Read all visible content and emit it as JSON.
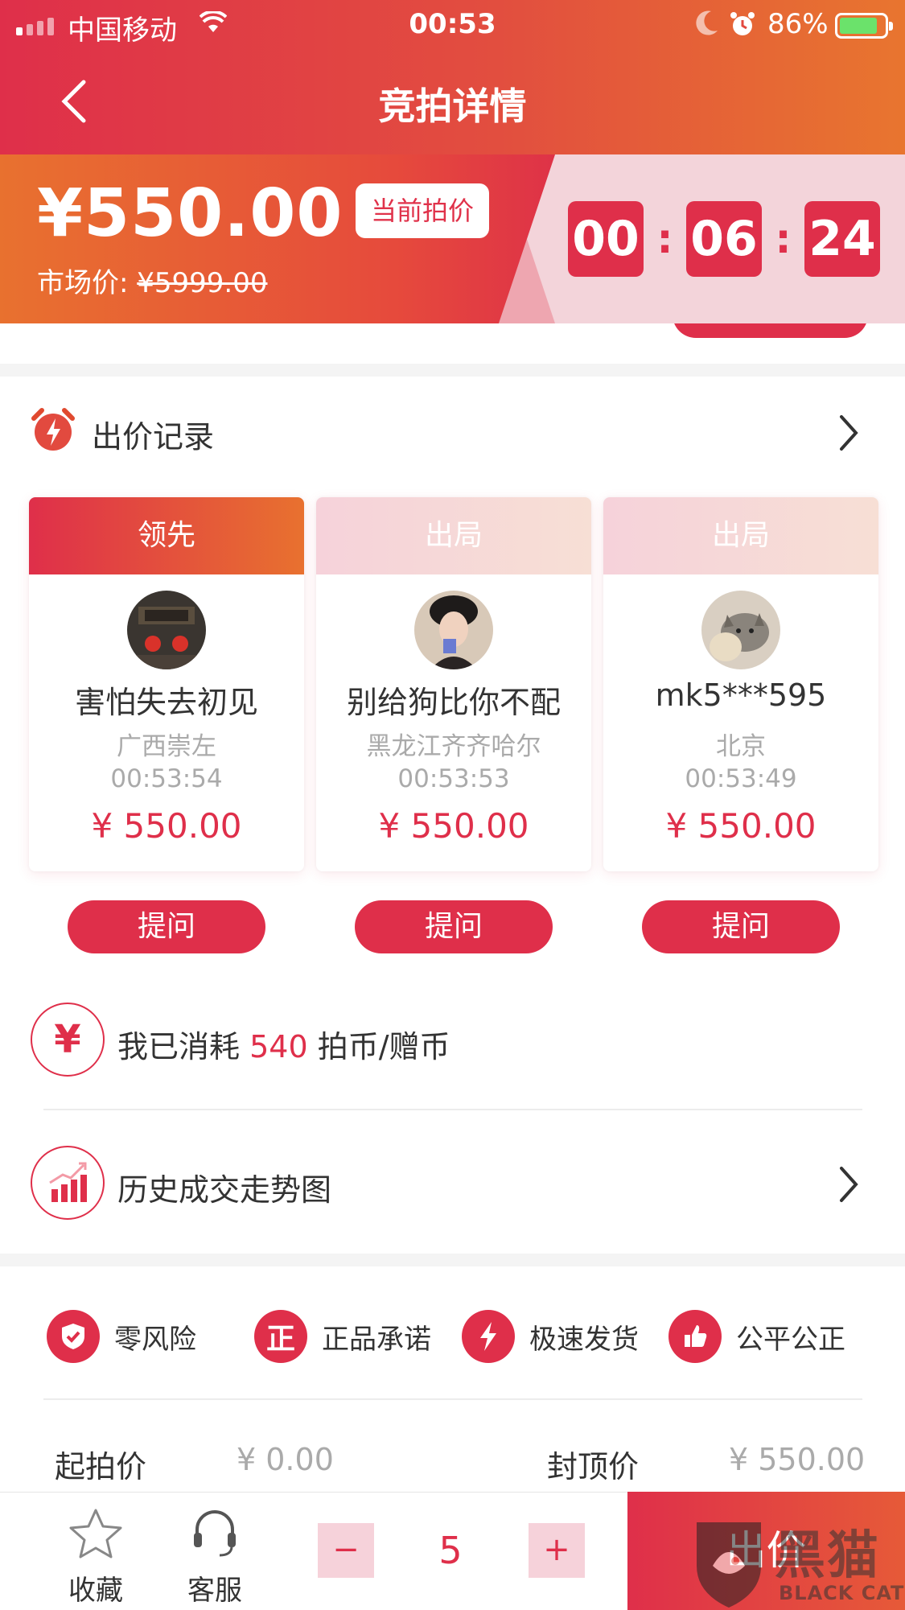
{
  "status_bar": {
    "carrier": "中国移动",
    "time": "00:53",
    "battery": "86%",
    "battery_level": 0.86
  },
  "nav": {
    "title": "竞拍详情"
  },
  "banner": {
    "price": "¥550.00",
    "price_tag": "当前拍价",
    "market_label": "市场价: ",
    "market_price": "¥5999.00",
    "timer": [
      "00",
      "06",
      "24"
    ],
    "timer_sep": ":"
  },
  "bid_records": {
    "title": "出价记录",
    "bids": [
      {
        "status": "领先",
        "name": "害怕失去初见",
        "location": "广西崇左",
        "time": "00:53:54",
        "amount": "¥ 550.00"
      },
      {
        "status": "出局",
        "name": "别给狗比你不配",
        "location": "黑龙江齐齐哈尔",
        "time": "00:53:53",
        "amount": "¥ 550.00"
      },
      {
        "status": "出局",
        "name": "mk5***595",
        "location": "北京",
        "time": "00:53:49",
        "amount": "¥ 550.00"
      }
    ],
    "ask_label": "提问"
  },
  "consume": {
    "prefix": "我已消耗 ",
    "amount": "540",
    "suffix": " 拍币/赠币",
    "icon_text": "¥"
  },
  "history": {
    "label": "历史成交走势图"
  },
  "guarantees": [
    {
      "label": "零风险",
      "icon": "shield-check-icon"
    },
    {
      "label": "正品承诺",
      "icon": "genuine-icon",
      "icon_text": "正"
    },
    {
      "label": "极速发货",
      "icon": "lightning-icon"
    },
    {
      "label": "公平公正",
      "icon": "thumbs-up-icon"
    }
  ],
  "prices": {
    "start_label": "起拍价",
    "start_value": "¥ 0.00",
    "cap_label": "封顶价",
    "cap_value": "¥ 550.00"
  },
  "bottom_bar": {
    "favorite": "收藏",
    "service": "客服",
    "minus": "−",
    "quantity": "5",
    "plus": "+",
    "submit": "出价"
  },
  "watermark": {
    "text": "黑猫",
    "sub": "BLACK CAT"
  },
  "colors": {
    "accent": "#df2f4a",
    "orange": "#e8712f",
    "pink_light": "#f3d4da"
  }
}
